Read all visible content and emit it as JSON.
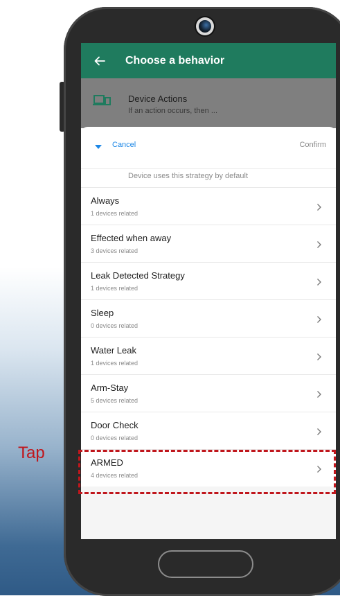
{
  "appbar": {
    "title": "Choose a behavior"
  },
  "background_row": {
    "title": "Device Actions",
    "subtitle": "If an action occurs, then ..."
  },
  "sheet": {
    "cancel_label": "Cancel",
    "confirm_label": "Confirm",
    "cutoff_text": "Device uses this strategy by default",
    "items": [
      {
        "title": "Always",
        "subtitle": "1 devices related"
      },
      {
        "title": "Effected when away",
        "subtitle": "3 devices related"
      },
      {
        "title": "Leak Detected Strategy",
        "subtitle": "1 devices related"
      },
      {
        "title": "Sleep",
        "subtitle": "0 devices related"
      },
      {
        "title": "Water Leak",
        "subtitle": "1 devices related"
      },
      {
        "title": "Arm-Stay",
        "subtitle": "5 devices related"
      },
      {
        "title": "Door Check",
        "subtitle": "0 devices related"
      },
      {
        "title": "ARMED",
        "subtitle": "4 devices related"
      }
    ]
  },
  "annotation": {
    "tap_label": "Tap"
  },
  "colors": {
    "appbar": "#1f7b5e",
    "accent_blue": "#1c87e6",
    "annotation_red": "#c0161c"
  }
}
